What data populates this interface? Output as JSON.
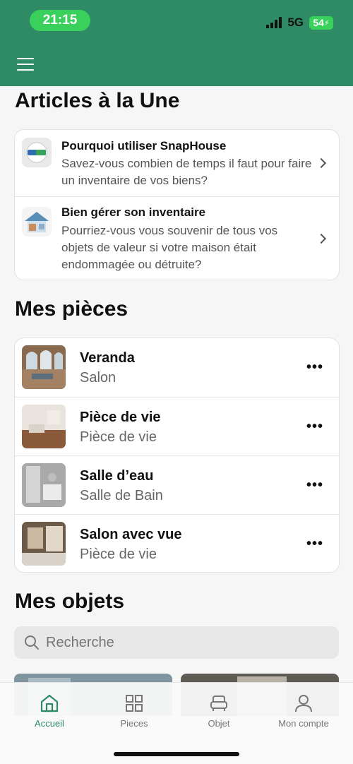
{
  "status": {
    "time": "21:15",
    "network": "5G",
    "battery": "54"
  },
  "featured": {
    "title": "Articles à la Une",
    "articles": [
      {
        "title": "Pourquoi utiliser SnapHouse",
        "description": "Savez-vous combien de temps il faut pour faire un inventaire de vos biens?",
        "icon": "snaphouse-logo-icon"
      },
      {
        "title": "Bien gérer son inventaire",
        "description": "Pourriez-vous vous souvenir de tous vos objets de valeur si votre maison était endommagée ou détruite?",
        "icon": "house-illustration-icon"
      }
    ]
  },
  "rooms": {
    "title": "Mes pièces",
    "items": [
      {
        "name": "Veranda",
        "type": "Salon",
        "more": "•••"
      },
      {
        "name": "Pièce de vie",
        "type": "Pièce de vie",
        "more": "•••"
      },
      {
        "name": "Salle d’eau",
        "type": "Salle de Bain",
        "more": "•••"
      },
      {
        "name": "Salon avec vue",
        "type": "Pièce de vie",
        "more": "•••"
      }
    ]
  },
  "objects": {
    "title": "Mes objets",
    "search_placeholder": "Recherche"
  },
  "tabbar": {
    "items": [
      {
        "label": "Accueil",
        "icon": "home-icon",
        "active": true
      },
      {
        "label": "Pieces",
        "icon": "grid-icon",
        "active": false
      },
      {
        "label": "Objet",
        "icon": "armchair-icon",
        "active": false
      },
      {
        "label": "Mon compte",
        "icon": "user-icon",
        "active": false
      }
    ]
  },
  "colors": {
    "brand": "#2f8a66",
    "status_pill": "#39d15c"
  }
}
